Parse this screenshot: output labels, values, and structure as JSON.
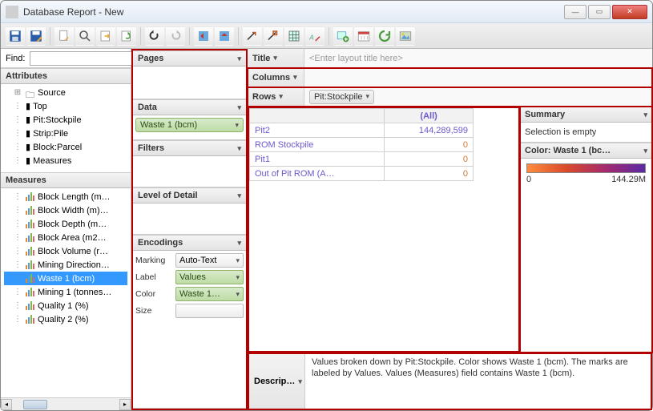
{
  "window": {
    "title": "Database Report - New"
  },
  "find": {
    "label": "Find:"
  },
  "sections": {
    "attributes": "Attributes",
    "measures": "Measures",
    "pages": "Pages",
    "data": "Data",
    "filters": "Filters",
    "lod": "Level of Detail",
    "encodings": "Encodings",
    "title": "Title",
    "columns": "Columns",
    "rows": "Rows",
    "summary": "Summary",
    "colorlegend": "Color: Waste 1 (bc…",
    "description": "Descrip…"
  },
  "attributes_tree": [
    "Source",
    "Top",
    "Pit:Stockpile",
    "Strip:Pile",
    "Block:Parcel",
    "Measures"
  ],
  "measures_tree": [
    "Block Length (m…",
    "Block Width (m)…",
    "Block Depth (m…",
    "Block Area (m2…",
    "Block Volume (r…",
    "Mining Direction…",
    "Waste 1 (bcm)",
    "Mining 1 (tonnes…",
    "Quality 1 (%)",
    "Quality 2 (%)"
  ],
  "shelves": {
    "data_pill": "Waste 1 (bcm)",
    "rows_pill": "Pit:Stockpile",
    "title_placeholder": "<Enter layout title here>"
  },
  "encodings": {
    "marking_label": "Marking",
    "label_label": "Label",
    "color_label": "Color",
    "size_label": "Size",
    "marking_value": "Auto-Text",
    "label_value": "Values",
    "color_value": "Waste 1…"
  },
  "table": {
    "header": "(All)",
    "rows": [
      {
        "label": "Pit2",
        "value": "144,289,599",
        "zero": false
      },
      {
        "label": "ROM Stockpile",
        "value": "0",
        "zero": true
      },
      {
        "label": "Pit1",
        "value": "0",
        "zero": true
      },
      {
        "label": "Out of Pit ROM (A…",
        "value": "0",
        "zero": true
      }
    ]
  },
  "summary": {
    "text": "Selection is empty",
    "legend_min": "0",
    "legend_max": "144.29M"
  },
  "description": {
    "text": "Values broken down by Pit:Stockpile. Color shows Waste 1 (bcm). The marks are labeled by Values. Values (Measures) field contains Waste 1 (bcm)."
  },
  "chart_data": {
    "type": "table",
    "group_by": "Pit:Stockpile",
    "measure": "Waste 1 (bcm)",
    "categories": [
      "Pit2",
      "ROM Stockpile",
      "Pit1",
      "Out of Pit ROM (A…)"
    ],
    "values": [
      144289599,
      0,
      0,
      0
    ],
    "color_field": "Waste 1 (bcm)",
    "color_scale": {
      "min": 0,
      "max": 144290000
    }
  }
}
